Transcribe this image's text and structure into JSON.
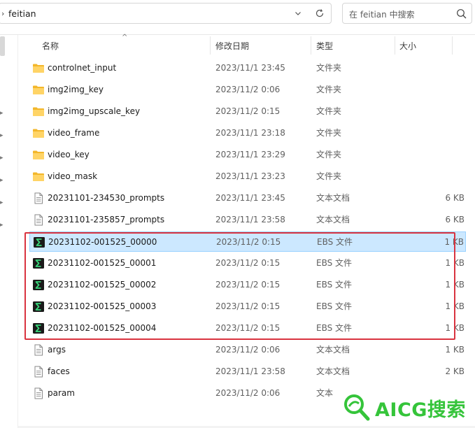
{
  "address": {
    "path": "feitian",
    "separator": "›"
  },
  "search": {
    "placeholder": "在 feitian 中搜索"
  },
  "columns": {
    "name": "名称",
    "date": "修改日期",
    "type": "类型",
    "size": "大小"
  },
  "rows": [
    {
      "name": "controlnet_input",
      "date": "2023/11/1 23:45",
      "type": "文件夹",
      "size": "",
      "icon": "folder-icon"
    },
    {
      "name": "img2img_key",
      "date": "2023/11/2 0:06",
      "type": "文件夹",
      "size": "",
      "icon": "folder-icon"
    },
    {
      "name": "img2img_upscale_key",
      "date": "2023/11/2 0:15",
      "type": "文件夹",
      "size": "",
      "icon": "folder-icon"
    },
    {
      "name": "video_frame",
      "date": "2023/11/1 23:18",
      "type": "文件夹",
      "size": "",
      "icon": "folder-icon"
    },
    {
      "name": "video_key",
      "date": "2023/11/1 23:29",
      "type": "文件夹",
      "size": "",
      "icon": "folder-icon"
    },
    {
      "name": "video_mask",
      "date": "2023/11/1 23:23",
      "type": "文件夹",
      "size": "",
      "icon": "folder-icon"
    },
    {
      "name": "20231101-234530_prompts",
      "date": "2023/11/1 23:45",
      "type": "文本文档",
      "size": "6 KB",
      "icon": "text-file-icon"
    },
    {
      "name": "20231101-235857_prompts",
      "date": "2023/11/1 23:58",
      "type": "文本文档",
      "size": "6 KB",
      "icon": "text-file-icon"
    },
    {
      "name": "20231102-001525_00000",
      "date": "2023/11/2 0:15",
      "type": "EBS 文件",
      "size": "1 KB",
      "icon": "ebs-file-icon",
      "selected": true
    },
    {
      "name": "20231102-001525_00001",
      "date": "2023/11/2 0:15",
      "type": "EBS 文件",
      "size": "1 KB",
      "icon": "ebs-file-icon"
    },
    {
      "name": "20231102-001525_00002",
      "date": "2023/11/2 0:15",
      "type": "EBS 文件",
      "size": "1 KB",
      "icon": "ebs-file-icon"
    },
    {
      "name": "20231102-001525_00003",
      "date": "2023/11/2 0:15",
      "type": "EBS 文件",
      "size": "1 KB",
      "icon": "ebs-file-icon"
    },
    {
      "name": "20231102-001525_00004",
      "date": "2023/11/2 0:15",
      "type": "EBS 文件",
      "size": "1 KB",
      "icon": "ebs-file-icon"
    },
    {
      "name": "args",
      "date": "2023/11/2 0:06",
      "type": "文本文档",
      "size": "1 KB",
      "icon": "text-file-icon"
    },
    {
      "name": "faces",
      "date": "2023/11/1 23:58",
      "type": "文本文档",
      "size": "2 KB",
      "icon": "text-file-icon"
    },
    {
      "name": "param",
      "date": "2023/11/2 0:06",
      "type": "文本",
      "size": "",
      "icon": "text-file-icon"
    }
  ],
  "watermark": {
    "text": "AICG搜索"
  },
  "colors": {
    "selection": "#cce8ff",
    "highlight_border": "#d9333f",
    "folder": "#f7c948",
    "watermark": "#35c43a"
  }
}
